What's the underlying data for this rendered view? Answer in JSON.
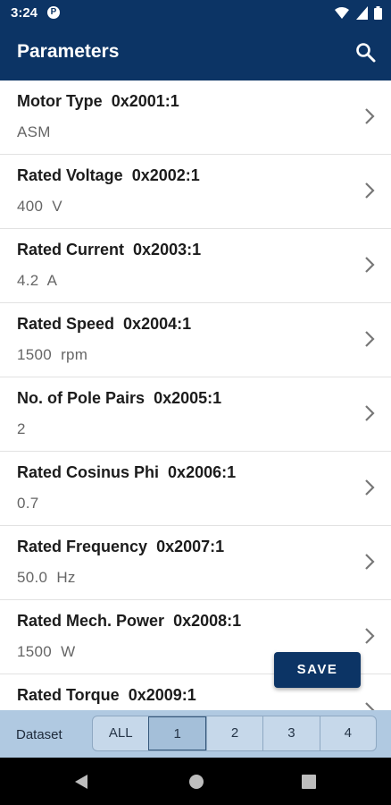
{
  "status": {
    "time": "3:24",
    "app_glyph": "P"
  },
  "appbar": {
    "title": "Parameters",
    "search_icon": "search-icon"
  },
  "params": [
    {
      "name": "Motor Type",
      "index": "0x2001:1",
      "value": "ASM"
    },
    {
      "name": "Rated Voltage",
      "index": "0x2002:1",
      "value": "400  V"
    },
    {
      "name": "Rated Current",
      "index": "0x2003:1",
      "value": "4.2  A"
    },
    {
      "name": "Rated Speed",
      "index": "0x2004:1",
      "value": "1500  rpm"
    },
    {
      "name": "No. of Pole Pairs",
      "index": "0x2005:1",
      "value": "2"
    },
    {
      "name": "Rated Cosinus Phi",
      "index": "0x2006:1",
      "value": "0.7"
    },
    {
      "name": "Rated Frequency",
      "index": "0x2007:1",
      "value": "50.0  Hz"
    },
    {
      "name": "Rated Mech. Power",
      "index": "0x2008:1",
      "value": "1500  W"
    },
    {
      "name": "Rated Torque",
      "index": "0x2009:1",
      "value": ""
    }
  ],
  "save_label": "SAVE",
  "dataset": {
    "label": "Dataset",
    "options": [
      "ALL",
      "1",
      "2",
      "3",
      "4"
    ],
    "selected": "1"
  },
  "colors": {
    "primary": "#0c3465",
    "dataset_bar": "#b0c9e1"
  }
}
